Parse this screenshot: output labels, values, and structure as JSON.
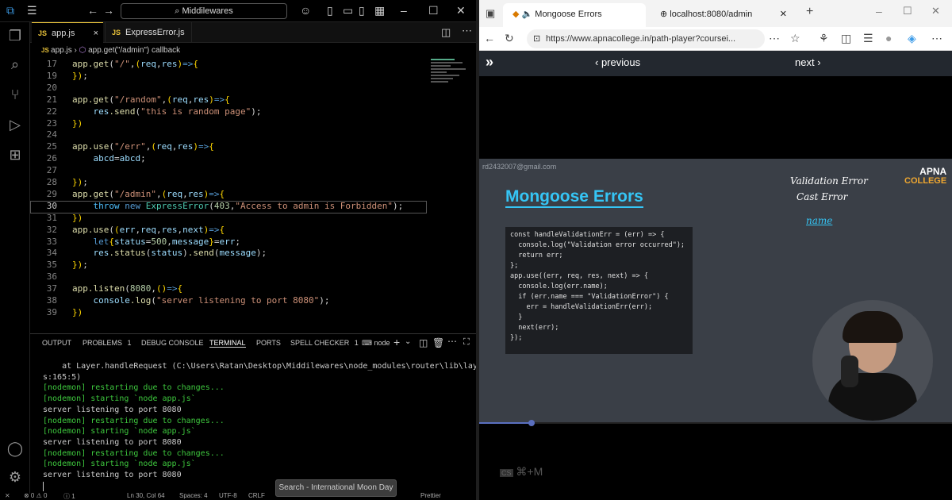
{
  "vscode": {
    "search_text": "Middilewares",
    "tabs": [
      {
        "icon": "JS",
        "label": "app.js",
        "close": "×"
      },
      {
        "icon": "JS",
        "label": "ExpressError.js"
      }
    ],
    "breadcrumb": {
      "file": "app.js",
      "sep": "›",
      "symbol": "app.get(\"/admin\") callback"
    },
    "line_numbers": [
      "17",
      "19",
      "20",
      "21",
      "22",
      "23",
      "24",
      "25",
      "26",
      "27",
      "28",
      "29",
      "30",
      "31",
      "32",
      "33",
      "34",
      "35",
      "36",
      "37",
      "38",
      "39"
    ],
    "panel_tabs": [
      {
        "label": "OUTPUT"
      },
      {
        "label": "PROBLEMS",
        "count": "1"
      },
      {
        "label": "DEBUG CONSOLE"
      },
      {
        "label": "TERMINAL"
      },
      {
        "label": "PORTS"
      },
      {
        "label": "SPELL CHECKER",
        "count": "1"
      }
    ],
    "terminal_shell": "node",
    "terminal_lines": [
      "    at Layer.handleRequest (C:\\Users\\Ratan\\Desktop\\Middilewares\\node_modules\\router\\lib\\layer.j",
      "s:165:5)",
      "[nodemon] restarting due to changes...",
      "[nodemon] starting `node app.js`",
      "server listening to port 8080",
      "[nodemon] restarting due to changes...",
      "[nodemon] starting `node app.js`",
      "server listening to port 8080",
      "[nodemon] restarting due to changes...",
      "[nodemon] starting `node app.js`",
      "server listening to port 8080"
    ],
    "status": {
      "problems": "⊗ 0 ⚠ 0",
      "info": "ⓘ 1",
      "position": "Ln 30, Col 64",
      "spaces": "Spaces: 4",
      "encoding": "UTF-8",
      "eol": "CRLF",
      "formatter": "Prettier"
    },
    "tooltip": "Search - International Moon Day"
  },
  "browser": {
    "tabs": [
      {
        "label": "Mongoose Errors"
      },
      {
        "label": "localhost:8080/admin"
      }
    ],
    "url": "https://www.apnacollege.in/path-player?coursei...",
    "nav": {
      "previous": "previous",
      "next": "next"
    },
    "slide": {
      "email": "rd2432007@gmail.com",
      "title": "Mongoose Errors",
      "logo_top": "APNA",
      "logo_bottom": "COLLEGE",
      "handwriting": [
        "Validation Error",
        "Cast Error",
        "name"
      ],
      "code_lines": [
        "const handleValidationErr = (err) => {",
        "  console.log(\"Validation error occurred\");",
        "  return err;",
        "};",
        "",
        "app.use((err, req, res, next) => {",
        "  console.log(err.name);",
        "  if (err.name === \"ValidationError\") {",
        "    err = handleValidationErr(err);",
        "  }",
        "  next(err);",
        "});"
      ]
    },
    "progress_fraction": 0.11,
    "shortcut": "⌘+M"
  }
}
